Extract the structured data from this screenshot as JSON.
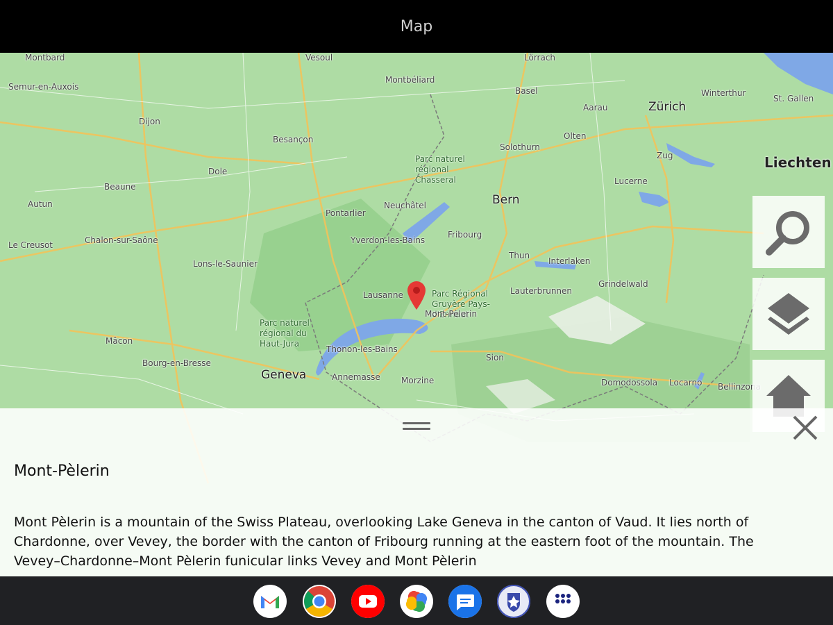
{
  "window": {
    "title": "Map"
  },
  "map": {
    "places": [
      {
        "name": "Montbard",
        "cls": ""
      },
      {
        "name": "Vesoul",
        "cls": ""
      },
      {
        "name": "Lörrach",
        "cls": ""
      },
      {
        "name": "Semur-en-Auxois",
        "cls": ""
      },
      {
        "name": "Montbéliard",
        "cls": ""
      },
      {
        "name": "Basel",
        "cls": ""
      },
      {
        "name": "Winterthur",
        "cls": ""
      },
      {
        "name": "St. Gallen",
        "cls": ""
      },
      {
        "name": "Aarau",
        "cls": ""
      },
      {
        "name": "Zürich",
        "cls": "big"
      },
      {
        "name": "Dijon",
        "cls": ""
      },
      {
        "name": "Besançon",
        "cls": ""
      },
      {
        "name": "Olten",
        "cls": ""
      },
      {
        "name": "Solothurn",
        "cls": ""
      },
      {
        "name": "Zug",
        "cls": ""
      },
      {
        "name": "Liechten",
        "cls": "bold"
      },
      {
        "name": "Dole",
        "cls": ""
      },
      {
        "name": "Parc naturel régional Chasseral",
        "cls": "green"
      },
      {
        "name": "Beaune",
        "cls": ""
      },
      {
        "name": "Lucerne",
        "cls": ""
      },
      {
        "name": "Autun",
        "cls": ""
      },
      {
        "name": "Neuchâtel",
        "cls": ""
      },
      {
        "name": "Bern",
        "cls": "big"
      },
      {
        "name": "Pontarlier",
        "cls": ""
      },
      {
        "name": "Le Creusot",
        "cls": ""
      },
      {
        "name": "Chalon-sur-Saône",
        "cls": ""
      },
      {
        "name": "Yverdon-les-Bains",
        "cls": ""
      },
      {
        "name": "Fribourg",
        "cls": ""
      },
      {
        "name": "Lons-le-Saunier",
        "cls": ""
      },
      {
        "name": "Thun",
        "cls": ""
      },
      {
        "name": "Interlaken",
        "cls": ""
      },
      {
        "name": "Grindelwald",
        "cls": ""
      },
      {
        "name": "Lausanne",
        "cls": ""
      },
      {
        "name": "Lauterbrunnen",
        "cls": ""
      },
      {
        "name": "Parc Régional Gruyère Pays-d'Enhaut",
        "cls": "green"
      },
      {
        "name": "Parc naturel régional du Haut-Jura",
        "cls": "green"
      },
      {
        "name": "Mont-Pèlerin",
        "cls": ""
      },
      {
        "name": "Mâcon",
        "cls": ""
      },
      {
        "name": "Thonon-les-Bains",
        "cls": ""
      },
      {
        "name": "Sion",
        "cls": ""
      },
      {
        "name": "Bourg-en-Bresse",
        "cls": ""
      },
      {
        "name": "Geneva",
        "cls": "big"
      },
      {
        "name": "Annemasse",
        "cls": ""
      },
      {
        "name": "Morzine",
        "cls": ""
      },
      {
        "name": "Domodossola",
        "cls": ""
      },
      {
        "name": "Locarno",
        "cls": ""
      },
      {
        "name": "Bellinzona",
        "cls": ""
      }
    ]
  },
  "controls": {
    "search_icon": "search-icon",
    "layers_icon": "layers-icon",
    "home_icon": "home-icon"
  },
  "panel": {
    "title": "Mont-Pèlerin",
    "description": "Mont Pèlerin is a mountain of the Swiss Plateau, overlooking Lake Geneva in the canton of Vaud. It lies north of\nChardonne, over Vevey, the border with the canton of Fribourg running at the eastern foot of the mountain. The\nVevey–Chardonne–Mont Pèlerin funicular links Vevey and Mont Pèlerin"
  },
  "taskbar": {
    "apps": [
      "gmail-icon",
      "chrome-icon",
      "youtube-icon",
      "photos-icon",
      "messages-icon",
      "app-crest-icon",
      "app-launcher-icon"
    ]
  },
  "colors": {
    "map_land": "#a9d8a0",
    "water": "#7fa8e6",
    "road": "#f2c35a",
    "marker": "#e53935",
    "taskbar": "#202124"
  }
}
